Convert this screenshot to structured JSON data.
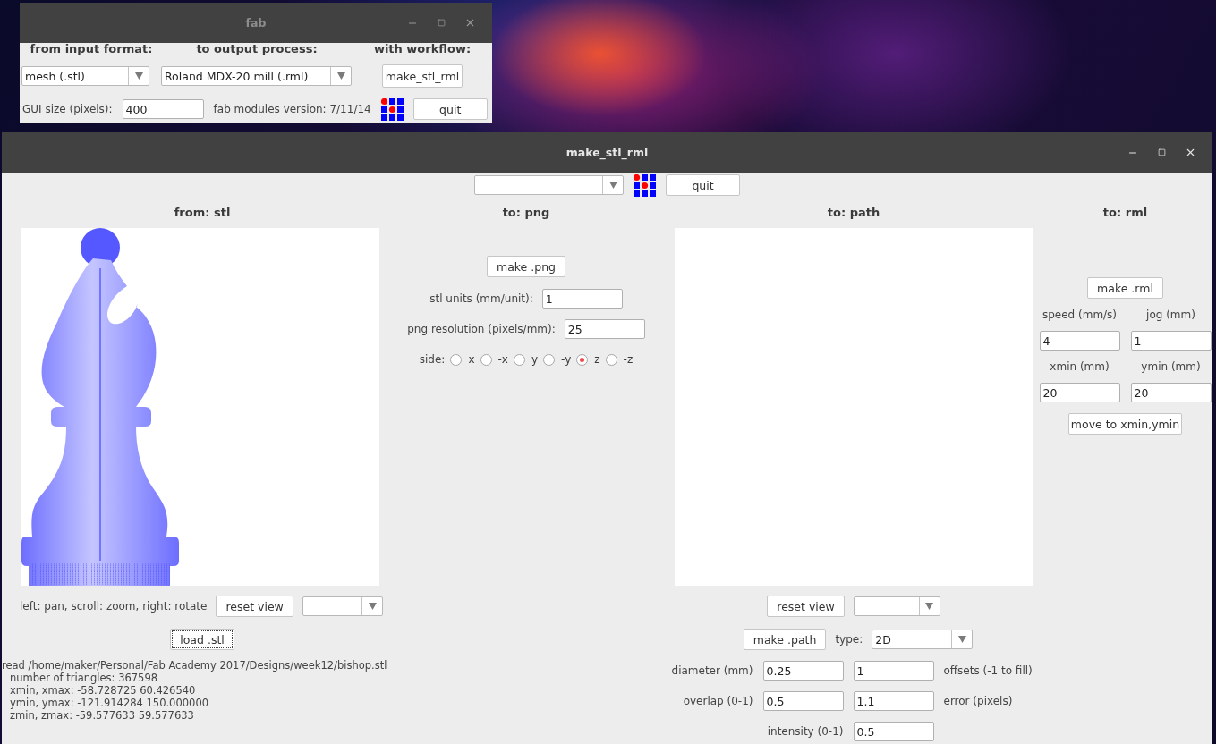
{
  "fab_window": {
    "title": "fab",
    "headers": [
      "from input format:",
      "to output process:",
      "with workflow:"
    ],
    "input_format": "mesh (.stl)",
    "output_process": "Roland MDX-20 mill (.rml)",
    "workflow_button": "make_stl_rml",
    "gui_size_label": "GUI size (pixels):",
    "gui_size": "400",
    "version": "fab modules version: 7/11/14",
    "quit_button": "quit"
  },
  "main_window": {
    "title": "make_stl_rml",
    "quit_button": "quit",
    "from": {
      "heading": "from: stl",
      "hint": "left: pan, scroll: zoom, right: rotate",
      "reset_button": "reset view",
      "load_button": {
        "label": "load .stl",
        "focused": true
      },
      "log": [
        "read /home/maker/Personal/Fab Academy 2017/Designs/week12/bishop.stl",
        "number of triangles: 367598",
        "xmin, xmax: -58.728725 60.426540",
        "ymin, ymax: -121.914284 150.000000",
        "zmin, zmax: -59.577633 59.577633"
      ]
    },
    "png": {
      "heading": "to: png",
      "make_button": "make .png",
      "fields": [
        {
          "label": "stl units (mm/unit):",
          "value": "1"
        },
        {
          "label": "png resolution (pixels/mm):",
          "value": "25"
        }
      ],
      "side_label": "side:",
      "sides": [
        {
          "label": "x",
          "selected": false
        },
        {
          "label": "-x",
          "selected": false
        },
        {
          "label": "y",
          "selected": false
        },
        {
          "label": "-y",
          "selected": false
        },
        {
          "label": "z",
          "selected": true
        },
        {
          "label": "-z",
          "selected": false
        }
      ]
    },
    "path": {
      "heading": "to: path",
      "reset_button": "reset view",
      "make_button": "make .path",
      "type_label": "type:",
      "type_value": "2D",
      "rows": [
        {
          "label": "diameter (mm)",
          "value": "0.25",
          "value2": "1",
          "note": "offsets (-1 to fill)"
        },
        {
          "label": "overlap (0-1)",
          "value": "0.5",
          "value2": "1.1",
          "note": "error (pixels)"
        }
      ],
      "intensity": {
        "label": "intensity (0-1)",
        "value": "0.5"
      }
    },
    "rml": {
      "heading": "to: rml",
      "make_button": "make .rml",
      "fields": [
        {
          "label": "speed (mm/s)",
          "value": "4"
        },
        {
          "label": "jog (mm)",
          "value": "1"
        },
        {
          "label": "xmin (mm)",
          "value": "20"
        },
        {
          "label": "ymin (mm)",
          "value": "20"
        }
      ],
      "move_button": "move to xmin,ymin"
    }
  }
}
